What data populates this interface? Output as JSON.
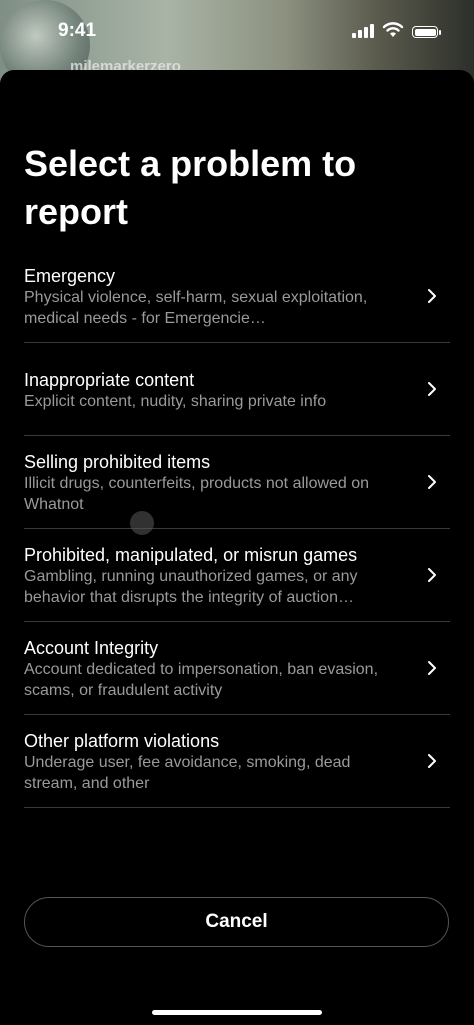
{
  "status": {
    "time": "9:41"
  },
  "background": {
    "username": "milemarkerzero"
  },
  "sheet": {
    "title": "Select a problem to report",
    "items": [
      {
        "title": "Emergency",
        "description": "Physical violence, self-harm, sexual exploitation, medical needs - for Emergencie…"
      },
      {
        "title": "Inappropriate content",
        "description": "Explicit content, nudity, sharing private info"
      },
      {
        "title": "Selling prohibited items",
        "description": "Illicit drugs, counterfeits, products not allowed on Whatnot"
      },
      {
        "title": "Prohibited, manipulated, or misrun games",
        "description": "Gambling, running unauthorized games, or any behavior that disrupts the integrity of auction…"
      },
      {
        "title": "Account Integrity",
        "description": "Account dedicated to impersonation, ban evasion, scams, or fraudulent activity"
      },
      {
        "title": "Other platform violations",
        "description": "Underage user, fee avoidance, smoking, dead stream, and other"
      }
    ],
    "cancel_label": "Cancel"
  },
  "icons": {
    "chevron": "chevron-right-icon",
    "signal": "cellular-signal-icon",
    "wifi": "wifi-icon",
    "battery": "battery-icon"
  }
}
